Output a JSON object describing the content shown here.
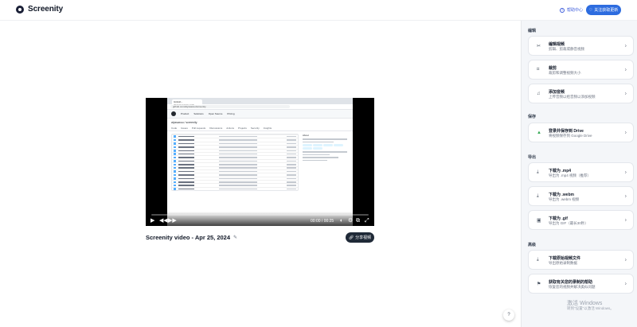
{
  "header": {
    "logo_text": "Screenity",
    "help_label": "帮助中心",
    "follow_label": "关注获取更新"
  },
  "video": {
    "title": "Screenity video - Apr 25, 2024",
    "time_current": "00:00",
    "time_separator": "/",
    "time_total": "00:25",
    "progress": 0.0,
    "share_label": "分享视频",
    "screen": {
      "tab_label": "GitHub - alyssaxuu/screenity",
      "url": "github.com/alyssaxuu/screenity",
      "nav_items": [
        "Product",
        "Solutions",
        "Open Source",
        "Pricing"
      ],
      "repo_name": "alyssaxuu / screenity",
      "repo_tabs": [
        "Code",
        "Issues",
        "Pull requests",
        "Discussions",
        "Actions",
        "Projects",
        "Security",
        "Insights"
      ],
      "about_title": "About"
    }
  },
  "sidebar": {
    "sections": [
      {
        "title": "编辑",
        "items": [
          {
            "icon": "scissors-icon",
            "glyph": "✂",
            "title": "编辑视频",
            "subtitle": "剪辑、剪裁或静音视频"
          },
          {
            "icon": "crop-icon",
            "glyph": "⌗",
            "title": "裁剪",
            "subtitle": "裁剪和调整视频大小"
          },
          {
            "icon": "music-icon",
            "glyph": "♫",
            "title": "添加音频",
            "subtitle": "上传音频以给音频以添加视频"
          }
        ]
      },
      {
        "title": "保存",
        "items": [
          {
            "icon": "google-drive-icon",
            "glyph": "▲",
            "title": "登录并保存到 Drive",
            "subtitle": "将视频保存到 Google Drive"
          }
        ]
      },
      {
        "title": "导出",
        "items": [
          {
            "icon": "download-icon",
            "glyph": "⤓",
            "title": "下载为 .mp4",
            "subtitle": "导出为 .mp4 视频（推荐）"
          },
          {
            "icon": "download-icon",
            "glyph": "⤓",
            "title": "下载为 .webm",
            "subtitle": "导出为 .webm 视频"
          },
          {
            "icon": "gif-icon",
            "glyph": "▣",
            "title": "下载为 .gif",
            "subtitle": "导出为 GIF（最长30秒）"
          }
        ]
      },
      {
        "title": "高级",
        "items": [
          {
            "icon": "download-icon",
            "glyph": "⤓",
            "title": "下载原始视频文件",
            "subtitle": "导出原始录制数据"
          },
          {
            "icon": "flag-icon",
            "glyph": "⚑",
            "title": "获取有关您的录制的帮助",
            "subtitle": "恢复您的视频并解决类似问题"
          }
        ]
      }
    ]
  },
  "help_fab": "?",
  "watermark": {
    "line1": "激活 Windows",
    "line2": "转到\"设置\"以激活 Windows。"
  },
  "colors": {
    "accent": "#2d6cdf",
    "dark_button": "#1f2937",
    "sidebar_bg": "#f4f6f9"
  }
}
